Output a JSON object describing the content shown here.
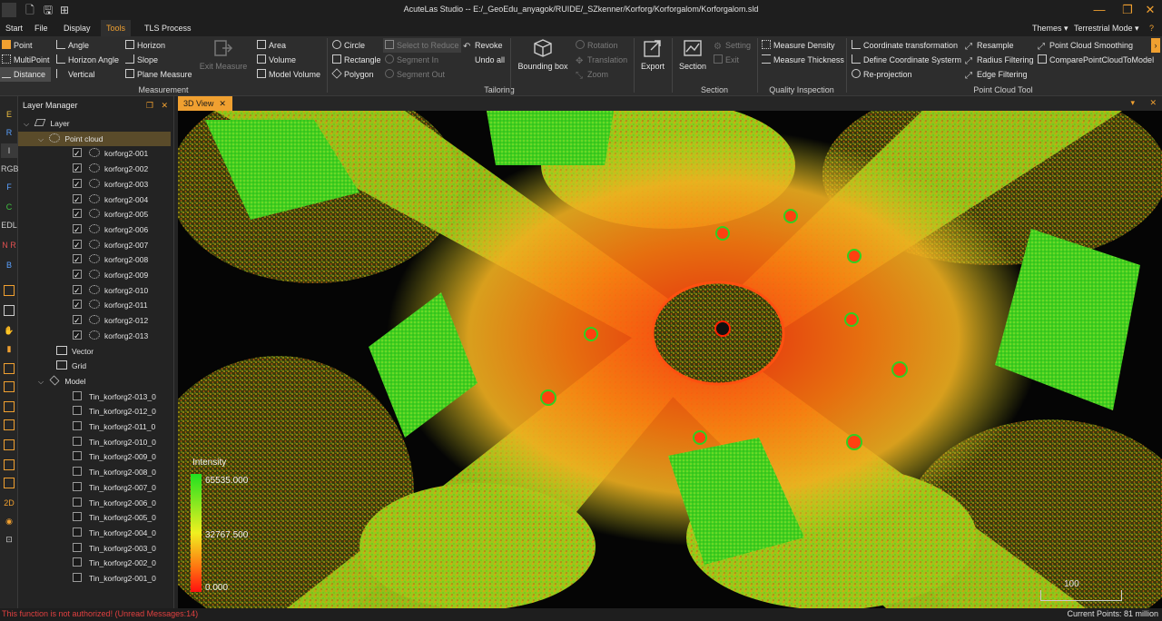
{
  "window": {
    "title": "AcuteLas Studio -- E:/_GeoEdu_anyagok/RUIDE/_SZkenner/Korforg/Korforgalom/Korforgalom.sld"
  },
  "menu": {
    "items": [
      "Start",
      "File",
      "Display",
      "Tools",
      "TLS Process"
    ],
    "active": "Tools",
    "themes": "Themes",
    "mode": "Terrestrial Mode"
  },
  "ribbon": {
    "measurement": {
      "point": "Point",
      "multipoint": "MultiPoint",
      "distance": "Distance",
      "angle": "Angle",
      "horizon_angle": "Horizon Angle",
      "vertical": "Vertical",
      "horizon": "Horizon",
      "slope": "Slope",
      "plane_measure": "Plane Measure",
      "exit_measure": "Exit Measure",
      "area": "Area",
      "volume": "Volume",
      "model_volume": "Model Volume",
      "group": "Measurement"
    },
    "tailoring": {
      "circle": "Circle",
      "rectangle": "Rectangle",
      "polygon": "Polygon",
      "select_to_reduce": "Select to Reduce",
      "segment_in": "Segment In",
      "segment_out": "Segment Out",
      "revoke": "Revoke",
      "undo_all": "Undo all",
      "group": "Tailoring"
    },
    "bounding_box": "Bounding box",
    "rotation": "Rotation",
    "translation": "Translation",
    "zoom": "Zoom",
    "export": "Export",
    "section": {
      "section": "Section",
      "setting": "Setting",
      "exit": "Exit",
      "group": "Section"
    },
    "quality": {
      "measure_density": "Measure Density",
      "measure_thickness": "Measure Thickness",
      "group": "Quality Inspection"
    },
    "pointcloud_tool": {
      "coordinate_transformation": "Coordinate transformation",
      "define_coordinate_system": "Define Coordinate Systerm",
      "re_projection": "Re-projection",
      "resample": "Resample",
      "radius_filtering": "Radius Filtering",
      "edge_filtering": "Edge Filtering",
      "point_cloud_smoothing": "Point Cloud Smoothing",
      "compare": "ComparePointCloudToModel",
      "group": "Point Cloud Tool"
    }
  },
  "left_toolbar": [
    "E",
    "R",
    "I",
    "RGB",
    "F",
    "C",
    "EDL",
    "N R",
    "B",
    "",
    "",
    "",
    "",
    "",
    "",
    "",
    "",
    "",
    "",
    "",
    "2D",
    "",
    ""
  ],
  "layer_manager": {
    "title": "Layer Manager",
    "root": "Layer",
    "point_cloud_group": "Point cloud",
    "point_clouds": [
      "korforg2-001",
      "korforg2-002",
      "korforg2-003",
      "korforg2-004",
      "korforg2-005",
      "korforg2-006",
      "korforg2-007",
      "korforg2-008",
      "korforg2-009",
      "korforg2-010",
      "korforg2-011",
      "korforg2-012",
      "korforg2-013"
    ],
    "vector": "Vector",
    "grid": "Grid",
    "model_group": "Model",
    "models": [
      "Tin_korforg2-013_0",
      "Tin_korforg2-012_0",
      "Tin_korforg2-011_0",
      "Tin_korforg2-010_0",
      "Tin_korforg2-009_0",
      "Tin_korforg2-008_0",
      "Tin_korforg2-007_0",
      "Tin_korforg2-006_0",
      "Tin_korforg2-005_0",
      "Tin_korforg2-004_0",
      "Tin_korforg2-003_0",
      "Tin_korforg2-002_0",
      "Tin_korforg2-001_0"
    ]
  },
  "view": {
    "tab": "3D View",
    "legend": {
      "title": "Intensity",
      "max": "65535.000",
      "mid": "32767.500",
      "min": "0.000"
    },
    "scale": "100"
  },
  "status": {
    "message": "This function is not authorized! (Unread Messages:14)",
    "current_points": "Current Points: 81 million"
  },
  "colors": {
    "accent": "#f0a030",
    "error": "#e04040"
  }
}
